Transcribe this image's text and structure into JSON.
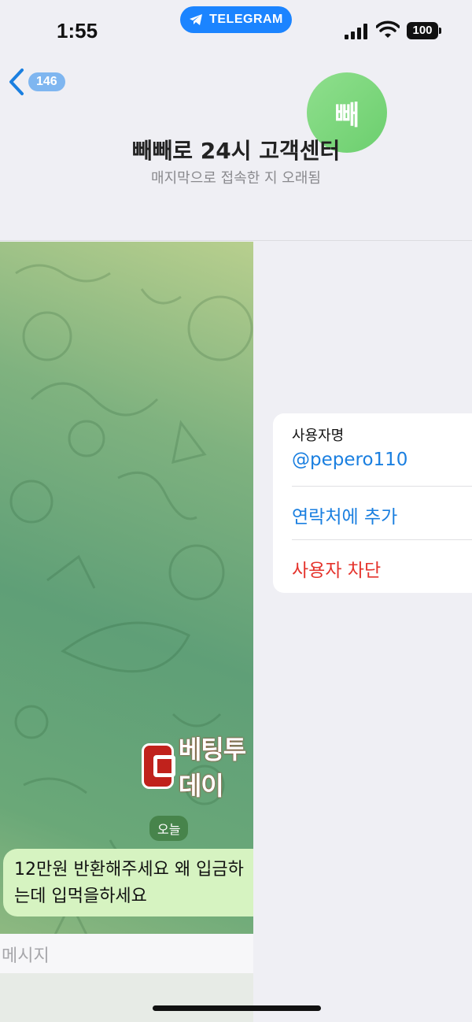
{
  "status_bar": {
    "time": "1:55",
    "app_pill": "TELEGRAM",
    "battery": "100"
  },
  "header": {
    "back_count": "146",
    "avatar_initial": "빼",
    "title": "빼빼로 24시 고객센터",
    "subtitle": "매지막으로 접속한 지 오래됨"
  },
  "chat": {
    "watermark": "베팅투데이",
    "day_label": "오늘",
    "message_line1": "12만원 반환해주세요 왜 입금하",
    "message_line2": "는데 입먹을하세요",
    "input_placeholder": "메시지"
  },
  "profile_card": {
    "username_label": "사용자명",
    "username_value": "@pepero110",
    "add_contact": "연락처에 추가",
    "block_user": "사용자 차단"
  },
  "colors": {
    "accent": "#1a7fe0",
    "danger": "#e5342d",
    "pill": "#1b84ff",
    "bubble": "#d6f3c1"
  }
}
